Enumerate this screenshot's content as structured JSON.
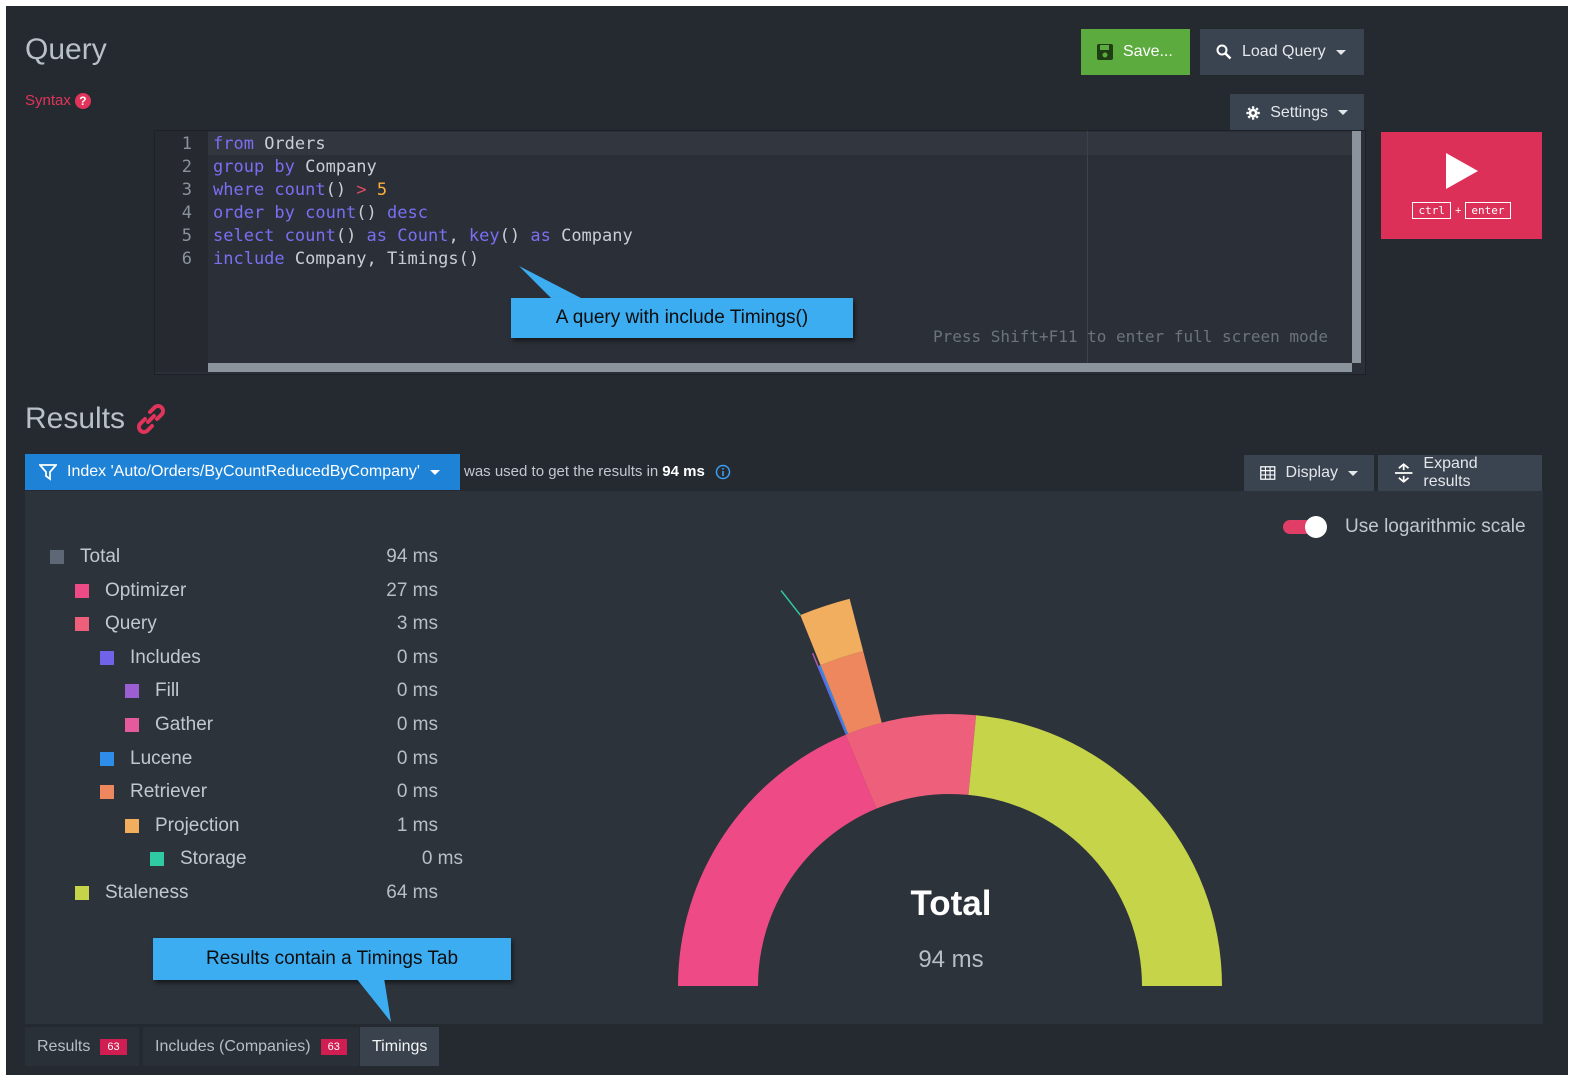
{
  "header": {
    "title": "Query",
    "syntax_label": "Syntax",
    "syntax_help": "?",
    "save_label": "Save...",
    "load_query_label": "Load Query",
    "settings_label": "Settings"
  },
  "editor": {
    "lines": [
      {
        "n": "1",
        "tokens": [
          {
            "t": "kw",
            "v": "from"
          },
          {
            "t": "plain",
            "v": " Orders"
          }
        ]
      },
      {
        "n": "2",
        "tokens": [
          {
            "t": "kw",
            "v": "group by"
          },
          {
            "t": "plain",
            "v": " Company"
          }
        ]
      },
      {
        "n": "3",
        "tokens": [
          {
            "t": "kw",
            "v": "where count"
          },
          {
            "t": "plain",
            "v": "() "
          },
          {
            "t": "op",
            "v": ">"
          },
          {
            "t": "plain",
            "v": " "
          },
          {
            "t": "num",
            "v": "5"
          }
        ]
      },
      {
        "n": "4",
        "tokens": [
          {
            "t": "kw",
            "v": "order by count"
          },
          {
            "t": "plain",
            "v": "() "
          },
          {
            "t": "kw",
            "v": "desc"
          }
        ]
      },
      {
        "n": "5",
        "tokens": [
          {
            "t": "kw",
            "v": "select count"
          },
          {
            "t": "plain",
            "v": "() "
          },
          {
            "t": "kw",
            "v": "as Count"
          },
          {
            "t": "plain",
            "v": ", "
          },
          {
            "t": "kw",
            "v": "key"
          },
          {
            "t": "plain",
            "v": "() "
          },
          {
            "t": "kw",
            "v": "as"
          },
          {
            "t": "plain",
            "v": " Company"
          }
        ]
      },
      {
        "n": "6",
        "tokens": [
          {
            "t": "kw",
            "v": "include"
          },
          {
            "t": "plain",
            "v": " Company, Timings()"
          }
        ]
      }
    ],
    "fullscreen_hint": "Press Shift+F11 to enter full screen mode"
  },
  "run": {
    "kbd_ctrl": "ctrl",
    "kbd_plus": "+",
    "kbd_enter": "enter"
  },
  "callouts": {
    "query": "A query with include Timings()",
    "results": "Results contain a Timings Tab"
  },
  "results": {
    "title": "Results",
    "index_label": "Index 'Auto/Orders/ByCountReducedByCompany'",
    "used_text": "was used to get the results in",
    "used_time": "94 ms",
    "display_label": "Display",
    "expand_label": "Expand results",
    "log_scale_label": "Use logarithmic scale",
    "log_scale_on": true
  },
  "timings": [
    {
      "name": "Total",
      "value": "94 ms",
      "ms": 94,
      "level": 0,
      "color": "#5e6775"
    },
    {
      "name": "Optimizer",
      "value": "27 ms",
      "ms": 27,
      "level": 1,
      "color": "#ee4b86"
    },
    {
      "name": "Query",
      "value": "3 ms",
      "ms": 3,
      "level": 1,
      "color": "#ee5f7b"
    },
    {
      "name": "Includes",
      "value": "0 ms",
      "ms": 0,
      "level": 2,
      "color": "#7163e8"
    },
    {
      "name": "Fill",
      "value": "0 ms",
      "ms": 0,
      "level": 3,
      "color": "#9b5fd1"
    },
    {
      "name": "Gather",
      "value": "0 ms",
      "ms": 0,
      "level": 3,
      "color": "#e45a9c"
    },
    {
      "name": "Lucene",
      "value": "0 ms",
      "ms": 0,
      "level": 2,
      "color": "#2e8de8"
    },
    {
      "name": "Retriever",
      "value": "0 ms",
      "ms": 0,
      "level": 2,
      "color": "#ef875e"
    },
    {
      "name": "Projection",
      "value": "1 ms",
      "ms": 1,
      "level": 3,
      "color": "#f2ae5f"
    },
    {
      "name": "Storage",
      "value": "0 ms",
      "ms": 0,
      "level": 4,
      "color": "#2fc9a3"
    },
    {
      "name": "Staleness",
      "value": "64 ms",
      "ms": 64,
      "level": 1,
      "color": "#c6d44a"
    }
  ],
  "center": {
    "label": "Total",
    "value": "94 ms"
  },
  "tabs": [
    {
      "label": "Results",
      "badge": "63",
      "active": false
    },
    {
      "label": "Includes (Companies)",
      "badge": "63",
      "active": false
    },
    {
      "label": "Timings",
      "badge": "",
      "active": true
    }
  ]
}
